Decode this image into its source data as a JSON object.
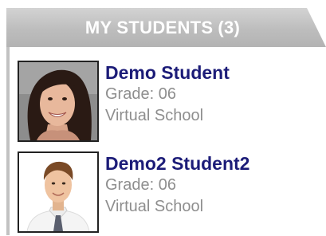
{
  "header": {
    "title": "MY STUDENTS",
    "count": "(3)"
  },
  "students": [
    {
      "name": "Demo Student",
      "grade": "Grade: 06",
      "school": "Virtual School"
    },
    {
      "name": "Demo2 Student2",
      "grade": "Grade: 06",
      "school": "Virtual School"
    }
  ],
  "colors": {
    "header_bg": "#bdbdbd",
    "header_text": "#ffffff",
    "name_link": "#1c1c78",
    "meta_text": "#8e8e8e"
  }
}
